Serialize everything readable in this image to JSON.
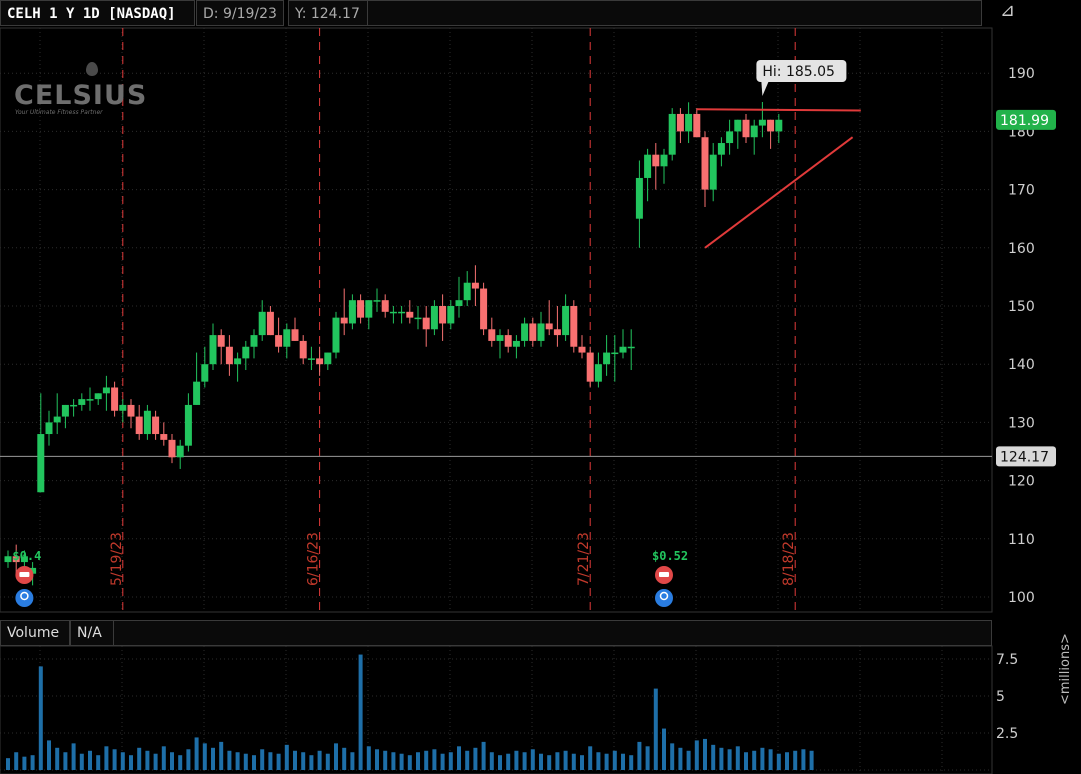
{
  "header": {
    "symbol": "CELH 1 Y 1D [NASDAQ]",
    "date": "D: 9/19/23",
    "value": "Y: 124.17"
  },
  "logo": {
    "text": "CELSIUS",
    "tagline": "Your Ultimate Fitness Partner"
  },
  "volume_panel": {
    "label": "Volume",
    "value": "N/A",
    "units": "<millions>"
  },
  "colors": {
    "up": "#22c55e",
    "down": "#f87171",
    "volume": "#1e6fa8",
    "trend": "#e03a3a",
    "last_price": "#21b24a"
  },
  "chart_data": {
    "type": "candlestick",
    "xlabel": "",
    "ylabel": "",
    "ylim": [
      97,
      200
    ],
    "yticks": [
      100,
      110,
      120,
      130,
      140,
      150,
      160,
      170,
      180,
      190
    ],
    "crosshair_y": 124.17,
    "crosshair_label": "124.17",
    "last_price": 181.99,
    "last_price_label": "181.99",
    "hi_label": "Hi: 185.05",
    "hi_value": 185.05,
    "date_markers": [
      "5/19/23",
      "6/16/23",
      "7/21/23",
      "8/18/23"
    ],
    "date_marker_bar_index": [
      14,
      38,
      71,
      96
    ],
    "dividend_labels": [
      {
        "text": "$0.4",
        "bar_index": 2
      },
      {
        "text": "$0.52",
        "bar_index": 80
      }
    ],
    "ohlc": [
      [
        106,
        108,
        105,
        107
      ],
      [
        107,
        109,
        104,
        106
      ],
      [
        106,
        108,
        103,
        107
      ],
      [
        104,
        106,
        102,
        105
      ],
      [
        118,
        135,
        118,
        128
      ],
      [
        128,
        132,
        126,
        130
      ],
      [
        130,
        135,
        128,
        131
      ],
      [
        131,
        133,
        129,
        133
      ],
      [
        133,
        134,
        131,
        133
      ],
      [
        133,
        135,
        132,
        134
      ],
      [
        134,
        136,
        132,
        134
      ],
      [
        134,
        135,
        133,
        135
      ],
      [
        135,
        138,
        132,
        136
      ],
      [
        136,
        137,
        131,
        132
      ],
      [
        132,
        134,
        130,
        133
      ],
      [
        133,
        134,
        129,
        131
      ],
      [
        131,
        133,
        127,
        128
      ],
      [
        128,
        133,
        127,
        132
      ],
      [
        131,
        132,
        127,
        128
      ],
      [
        128,
        130,
        126,
        127
      ],
      [
        127,
        128,
        123,
        124
      ],
      [
        124,
        127,
        122,
        126
      ],
      [
        126,
        135,
        125,
        133
      ],
      [
        133,
        142,
        133,
        137
      ],
      [
        137,
        143,
        136,
        140
      ],
      [
        140,
        147,
        139,
        145
      ],
      [
        145,
        146,
        140,
        143
      ],
      [
        143,
        145,
        138,
        140
      ],
      [
        140,
        142,
        137,
        141
      ],
      [
        141,
        144,
        139,
        143
      ],
      [
        143,
        146,
        141,
        145
      ],
      [
        145,
        151,
        144,
        149
      ],
      [
        149,
        150,
        145,
        145
      ],
      [
        145,
        148,
        142,
        143
      ],
      [
        143,
        147,
        141,
        146
      ],
      [
        146,
        148,
        144,
        144
      ],
      [
        144,
        145,
        140,
        141
      ],
      [
        141,
        143,
        139,
        141
      ],
      [
        141,
        143,
        138,
        140
      ],
      [
        140,
        142,
        139,
        142
      ],
      [
        142,
        149,
        141,
        148
      ],
      [
        148,
        153,
        145,
        147
      ],
      [
        147,
        152,
        146,
        151
      ],
      [
        151,
        152,
        147,
        148
      ],
      [
        148,
        151,
        146,
        151
      ],
      [
        151,
        153,
        149,
        151
      ],
      [
        151,
        152,
        148,
        149
      ],
      [
        149,
        150,
        147,
        149
      ],
      [
        149,
        150,
        147,
        149
      ],
      [
        149,
        151,
        147,
        148
      ],
      [
        148,
        150,
        146,
        148
      ],
      [
        148,
        150,
        143,
        146
      ],
      [
        146,
        151,
        145,
        150
      ],
      [
        150,
        152,
        144,
        147
      ],
      [
        147,
        151,
        146,
        150
      ],
      [
        150,
        155,
        148,
        151
      ],
      [
        151,
        156,
        150,
        154
      ],
      [
        154,
        157,
        150,
        153
      ],
      [
        153,
        154,
        145,
        146
      ],
      [
        146,
        148,
        143,
        144
      ],
      [
        144,
        146,
        141,
        145
      ],
      [
        145,
        146,
        142,
        143
      ],
      [
        143,
        145,
        141,
        144
      ],
      [
        144,
        148,
        143,
        147
      ],
      [
        147,
        148,
        143,
        144
      ],
      [
        144,
        149,
        143,
        147
      ],
      [
        147,
        151,
        145,
        146
      ],
      [
        146,
        150,
        143,
        145
      ],
      [
        145,
        152,
        144,
        150
      ],
      [
        150,
        151,
        142,
        143
      ],
      [
        143,
        145,
        141,
        142
      ],
      [
        142,
        143,
        136,
        137
      ],
      [
        137,
        142,
        136,
        140
      ],
      [
        140,
        145,
        138,
        142
      ],
      [
        142,
        145,
        137,
        142
      ],
      [
        142,
        146,
        141,
        143
      ],
      [
        143,
        146,
        139,
        143
      ],
      [
        165,
        175,
        160,
        172
      ],
      [
        172,
        177,
        168,
        176
      ],
      [
        176,
        178,
        170,
        174
      ],
      [
        174,
        177,
        171,
        176
      ],
      [
        176,
        184,
        175,
        183
      ],
      [
        183,
        184,
        178,
        180
      ],
      [
        180,
        185,
        178,
        183
      ],
      [
        183,
        184,
        179,
        179
      ],
      [
        179,
        180,
        167,
        170
      ],
      [
        170,
        178,
        168,
        176
      ],
      [
        176,
        179,
        174,
        178
      ],
      [
        178,
        182,
        176,
        180
      ],
      [
        180,
        182,
        177,
        182
      ],
      [
        182,
        183,
        178,
        179
      ],
      [
        179,
        182,
        176,
        181
      ],
      [
        181,
        185.05,
        179,
        182
      ],
      [
        182,
        182,
        177,
        180
      ],
      [
        180,
        183,
        178,
        182
      ]
    ],
    "volume_scale": [
      0,
      2.5,
      5,
      7.5
    ],
    "volume": [
      0.8,
      1.2,
      0.9,
      1.0,
      7.0,
      2.0,
      1.5,
      1.2,
      1.8,
      1.1,
      1.3,
      1.0,
      1.6,
      1.4,
      1.2,
      1.0,
      1.5,
      1.3,
      1.1,
      1.6,
      1.2,
      1.0,
      1.4,
      2.2,
      1.8,
      1.5,
      1.9,
      1.3,
      1.2,
      1.1,
      1.0,
      1.4,
      1.2,
      1.1,
      1.7,
      1.3,
      1.2,
      1.0,
      1.3,
      1.1,
      1.8,
      1.5,
      1.2,
      7.8,
      1.6,
      1.4,
      1.3,
      1.2,
      1.1,
      1.0,
      1.2,
      1.3,
      1.4,
      1.1,
      1.2,
      1.6,
      1.3,
      1.5,
      1.9,
      1.2,
      1.0,
      1.1,
      1.3,
      1.2,
      1.4,
      1.1,
      1.0,
      1.2,
      1.3,
      1.1,
      1.0,
      1.6,
      1.2,
      1.1,
      1.3,
      1.1,
      1.0,
      1.9,
      1.6,
      5.5,
      2.8,
      1.8,
      1.5,
      1.3,
      2.0,
      2.1,
      1.7,
      1.5,
      1.4,
      1.6,
      1.2,
      1.3,
      1.5,
      1.4,
      1.1,
      1.2,
      1.3,
      1.4,
      1.3
    ],
    "trendlines": [
      {
        "from": [
          84,
          183.8
        ],
        "to": [
          104,
          183.6
        ]
      },
      {
        "from": [
          85,
          160.0
        ],
        "to": [
          103,
          179.0
        ]
      }
    ]
  }
}
